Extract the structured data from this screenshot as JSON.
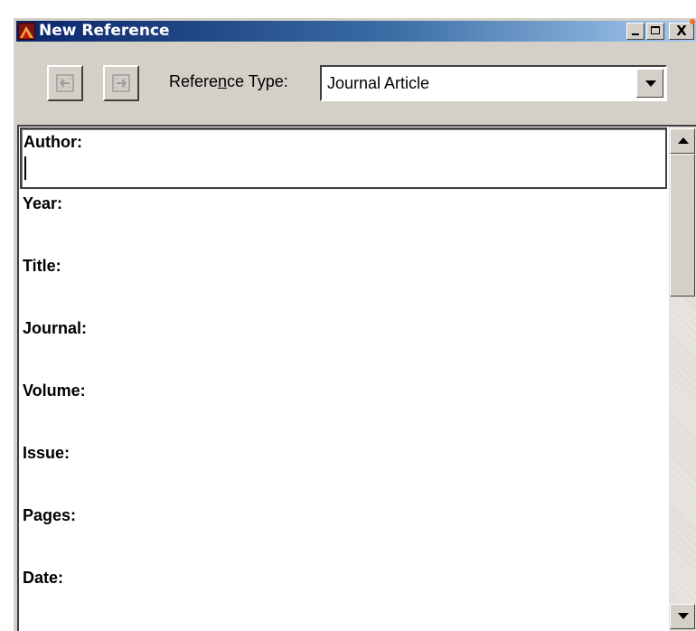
{
  "window": {
    "title": "New Reference",
    "controls": {
      "minimize": "_",
      "maximize": "□",
      "close": "X"
    }
  },
  "toolbar": {
    "prev_icon": "previous-reference-icon",
    "next_icon": "next-reference-icon",
    "ref_type_label_pre": "Refere",
    "ref_type_label_mnemonic": "n",
    "ref_type_label_post": "ce Type:",
    "ref_type_value": "Journal Article"
  },
  "fields": [
    {
      "label": "Author:",
      "value": ""
    },
    {
      "label": "Year:",
      "value": ""
    },
    {
      "label": "Title:",
      "value": ""
    },
    {
      "label": "Journal:",
      "value": ""
    },
    {
      "label": "Volume:",
      "value": ""
    },
    {
      "label": "Issue:",
      "value": ""
    },
    {
      "label": "Pages:",
      "value": ""
    },
    {
      "label": "Date:",
      "value": ""
    }
  ],
  "colors": {
    "titlebar_start": "#0a246a",
    "titlebar_end": "#a6caf0",
    "chrome": "#d4d0c8"
  }
}
